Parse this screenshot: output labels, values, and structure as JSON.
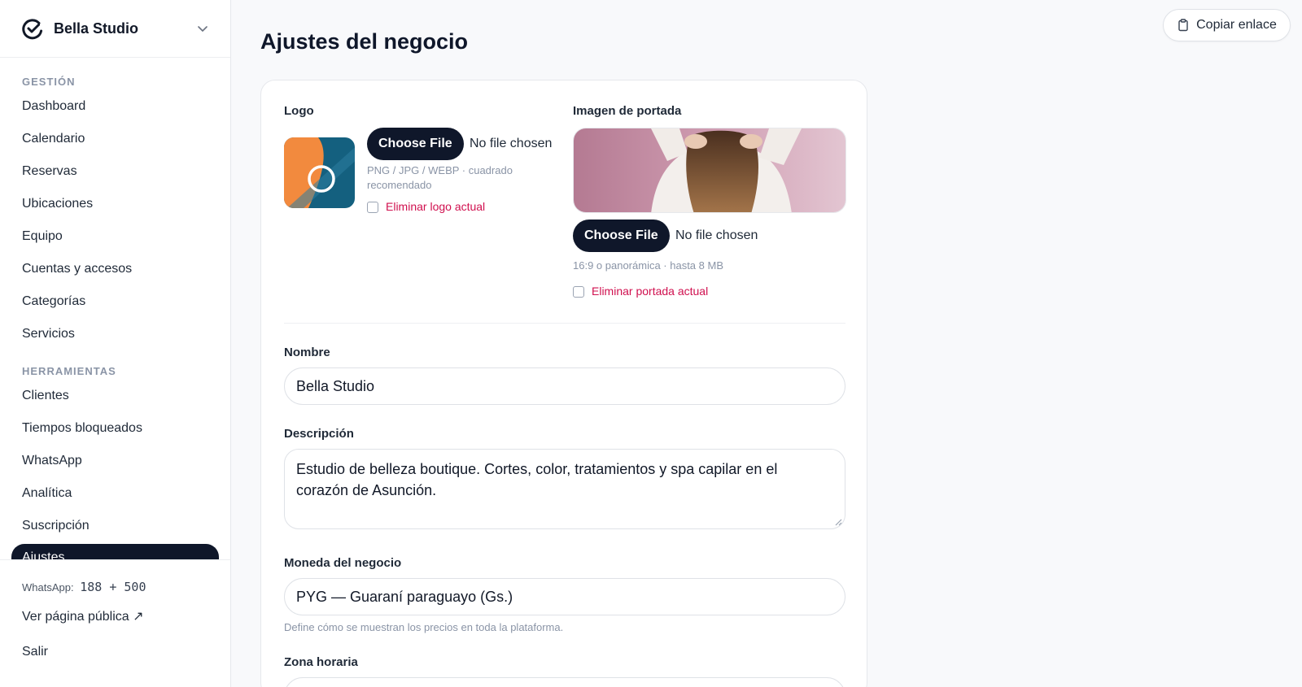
{
  "brand": {
    "name": "Bella Studio",
    "accent": "#0f172a"
  },
  "sidebar": {
    "section_management": "GESTIÓN",
    "management_items": [
      "Dashboard",
      "Calendario",
      "Reservas",
      "Ubicaciones",
      "Equipo",
      "Cuentas y accesos",
      "Categorías",
      "Servicios"
    ],
    "section_tools": "HERRAMIENTAS",
    "tool_items": [
      "Clientes",
      "Tiempos bloqueados",
      "WhatsApp",
      "Analítica",
      "Suscripción"
    ],
    "active_item": "Ajustes",
    "whatsapp_label": "WhatsApp:",
    "whatsapp_counts": "188 + 500",
    "public_page": "Ver página pública ↗",
    "logout": "Salir"
  },
  "header": {
    "copy_link": "Copiar enlace",
    "page_title": "Ajustes del negocio"
  },
  "form": {
    "logo": {
      "label": "Logo",
      "choose_file": "Choose File",
      "file_status": "No file chosen",
      "hint": "PNG / JPG / WEBP · cuadrado recomendado",
      "remove_label": "Eliminar logo actual"
    },
    "cover": {
      "label": "Imagen de portada",
      "choose_file": "Choose File",
      "file_status": "No file chosen",
      "hint": "16:9 o panorámica · hasta 8 MB",
      "remove_label": "Eliminar portada actual"
    },
    "name": {
      "label": "Nombre",
      "value": "Bella Studio"
    },
    "description": {
      "label": "Descripción",
      "value": "Estudio de belleza boutique. Cortes, color, tratamientos y spa capilar en el corazón de Asunción."
    },
    "currency": {
      "label": "Moneda del negocio",
      "value": "PYG — Guaraní paraguayo (Gs.)",
      "hint": "Define cómo se muestran los precios en toda la plataforma."
    },
    "timezone": {
      "label": "Zona horaria"
    }
  },
  "colors": {
    "danger": "#d0104f",
    "muted": "#8a94a6",
    "logo_orange": "#f28a3e",
    "logo_blue": "#14607f",
    "cover_pink": "#c98fa6"
  },
  "icons": [
    "checkmark-logo-icon",
    "chevron-down-icon",
    "clipboard-icon"
  ]
}
